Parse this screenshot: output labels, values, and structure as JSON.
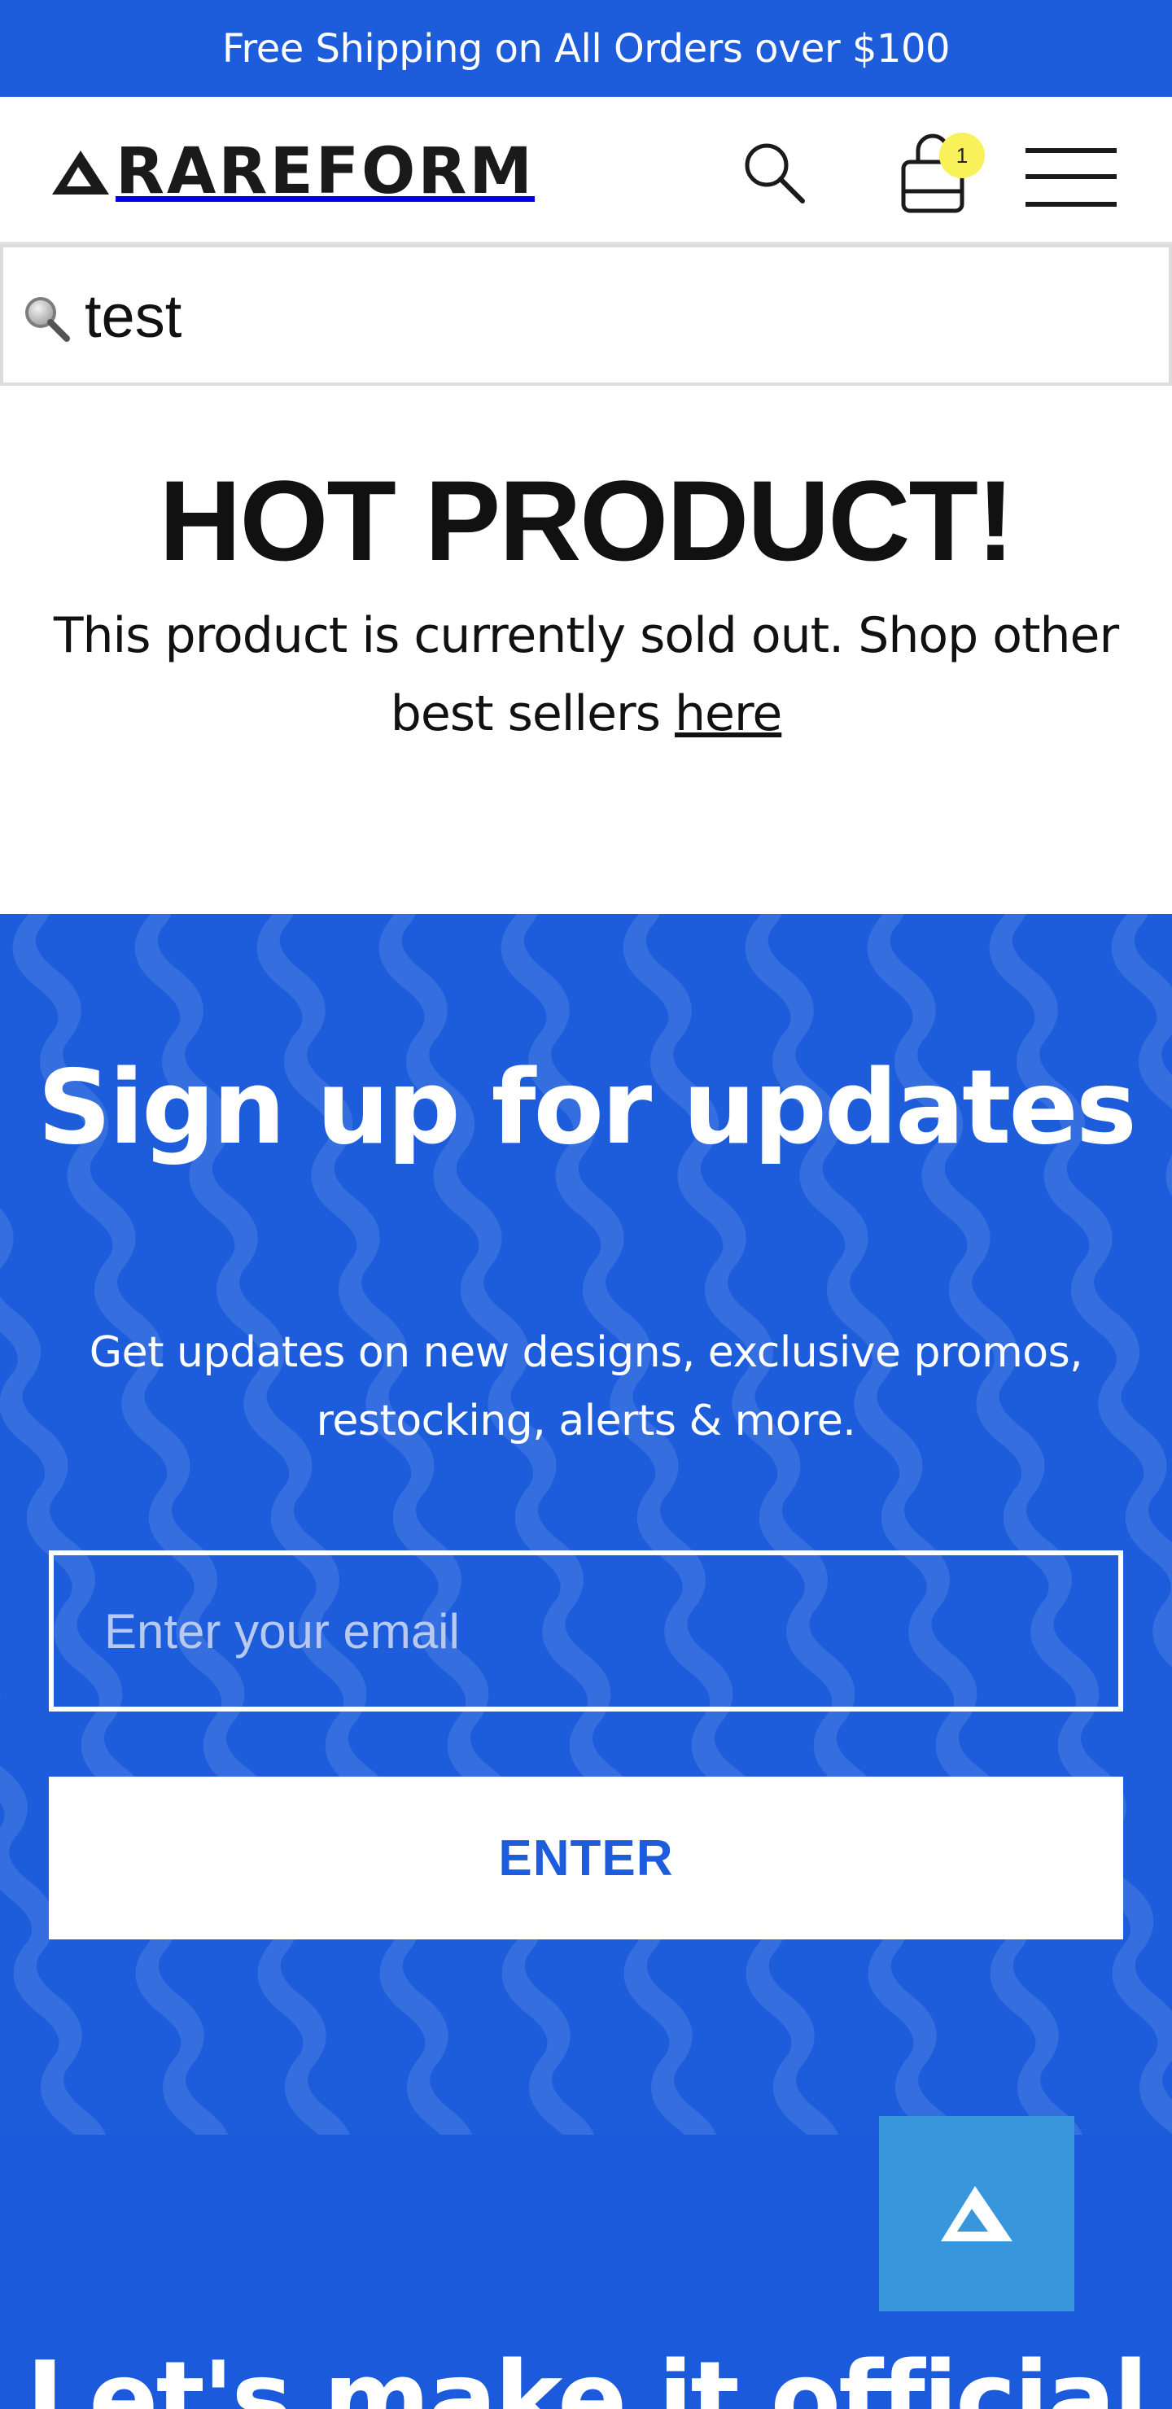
{
  "promo_bar": {
    "text": "Free Shipping on All Orders over $100"
  },
  "header": {
    "logo_text": "RAREFORM",
    "cart_count": "1"
  },
  "search": {
    "value": "test"
  },
  "notice": {
    "title": "HOT PRODUCT!",
    "message": "This product is currently sold out. Shop other best sellers",
    "link_text": "here"
  },
  "signup": {
    "title": "Sign up for updates",
    "description": "Get updates on new designs, exclusive promos, restocking, alerts & more.",
    "email_placeholder": "Enter your email",
    "button_label": "ENTER"
  },
  "footer_teaser": {
    "title": "Let's make it official"
  },
  "colors": {
    "brand_blue": "#1d5ddb",
    "badge_yellow": "#f8f15a",
    "fab_blue": "#3796dc"
  },
  "icons": [
    "rareform-logo-icon",
    "search-icon",
    "cart-icon",
    "menu-icon",
    "rareform-mark-icon"
  ]
}
